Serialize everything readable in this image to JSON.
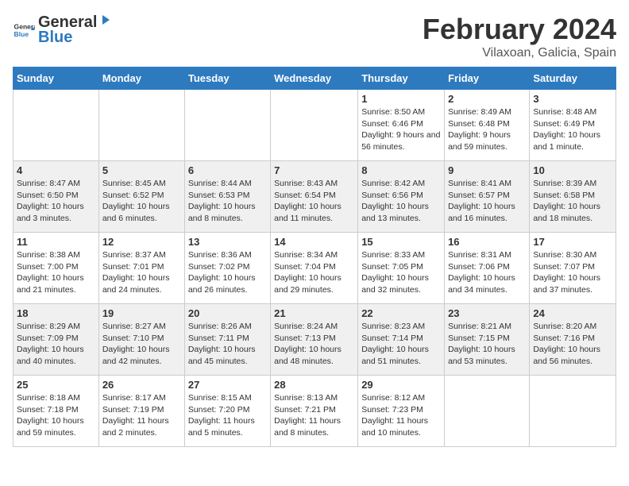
{
  "logo": {
    "text_general": "General",
    "text_blue": "Blue"
  },
  "title": "February 2024",
  "subtitle": "Vilaxoan, Galicia, Spain",
  "days_header": [
    "Sunday",
    "Monday",
    "Tuesday",
    "Wednesday",
    "Thursday",
    "Friday",
    "Saturday"
  ],
  "weeks": [
    [
      {
        "num": "",
        "info": ""
      },
      {
        "num": "",
        "info": ""
      },
      {
        "num": "",
        "info": ""
      },
      {
        "num": "",
        "info": ""
      },
      {
        "num": "1",
        "info": "Sunrise: 8:50 AM\nSunset: 6:46 PM\nDaylight: 9 hours and 56 minutes."
      },
      {
        "num": "2",
        "info": "Sunrise: 8:49 AM\nSunset: 6:48 PM\nDaylight: 9 hours and 59 minutes."
      },
      {
        "num": "3",
        "info": "Sunrise: 8:48 AM\nSunset: 6:49 PM\nDaylight: 10 hours and 1 minute."
      }
    ],
    [
      {
        "num": "4",
        "info": "Sunrise: 8:47 AM\nSunset: 6:50 PM\nDaylight: 10 hours and 3 minutes."
      },
      {
        "num": "5",
        "info": "Sunrise: 8:45 AM\nSunset: 6:52 PM\nDaylight: 10 hours and 6 minutes."
      },
      {
        "num": "6",
        "info": "Sunrise: 8:44 AM\nSunset: 6:53 PM\nDaylight: 10 hours and 8 minutes."
      },
      {
        "num": "7",
        "info": "Sunrise: 8:43 AM\nSunset: 6:54 PM\nDaylight: 10 hours and 11 minutes."
      },
      {
        "num": "8",
        "info": "Sunrise: 8:42 AM\nSunset: 6:56 PM\nDaylight: 10 hours and 13 minutes."
      },
      {
        "num": "9",
        "info": "Sunrise: 8:41 AM\nSunset: 6:57 PM\nDaylight: 10 hours and 16 minutes."
      },
      {
        "num": "10",
        "info": "Sunrise: 8:39 AM\nSunset: 6:58 PM\nDaylight: 10 hours and 18 minutes."
      }
    ],
    [
      {
        "num": "11",
        "info": "Sunrise: 8:38 AM\nSunset: 7:00 PM\nDaylight: 10 hours and 21 minutes."
      },
      {
        "num": "12",
        "info": "Sunrise: 8:37 AM\nSunset: 7:01 PM\nDaylight: 10 hours and 24 minutes."
      },
      {
        "num": "13",
        "info": "Sunrise: 8:36 AM\nSunset: 7:02 PM\nDaylight: 10 hours and 26 minutes."
      },
      {
        "num": "14",
        "info": "Sunrise: 8:34 AM\nSunset: 7:04 PM\nDaylight: 10 hours and 29 minutes."
      },
      {
        "num": "15",
        "info": "Sunrise: 8:33 AM\nSunset: 7:05 PM\nDaylight: 10 hours and 32 minutes."
      },
      {
        "num": "16",
        "info": "Sunrise: 8:31 AM\nSunset: 7:06 PM\nDaylight: 10 hours and 34 minutes."
      },
      {
        "num": "17",
        "info": "Sunrise: 8:30 AM\nSunset: 7:07 PM\nDaylight: 10 hours and 37 minutes."
      }
    ],
    [
      {
        "num": "18",
        "info": "Sunrise: 8:29 AM\nSunset: 7:09 PM\nDaylight: 10 hours and 40 minutes."
      },
      {
        "num": "19",
        "info": "Sunrise: 8:27 AM\nSunset: 7:10 PM\nDaylight: 10 hours and 42 minutes."
      },
      {
        "num": "20",
        "info": "Sunrise: 8:26 AM\nSunset: 7:11 PM\nDaylight: 10 hours and 45 minutes."
      },
      {
        "num": "21",
        "info": "Sunrise: 8:24 AM\nSunset: 7:13 PM\nDaylight: 10 hours and 48 minutes."
      },
      {
        "num": "22",
        "info": "Sunrise: 8:23 AM\nSunset: 7:14 PM\nDaylight: 10 hours and 51 minutes."
      },
      {
        "num": "23",
        "info": "Sunrise: 8:21 AM\nSunset: 7:15 PM\nDaylight: 10 hours and 53 minutes."
      },
      {
        "num": "24",
        "info": "Sunrise: 8:20 AM\nSunset: 7:16 PM\nDaylight: 10 hours and 56 minutes."
      }
    ],
    [
      {
        "num": "25",
        "info": "Sunrise: 8:18 AM\nSunset: 7:18 PM\nDaylight: 10 hours and 59 minutes."
      },
      {
        "num": "26",
        "info": "Sunrise: 8:17 AM\nSunset: 7:19 PM\nDaylight: 11 hours and 2 minutes."
      },
      {
        "num": "27",
        "info": "Sunrise: 8:15 AM\nSunset: 7:20 PM\nDaylight: 11 hours and 5 minutes."
      },
      {
        "num": "28",
        "info": "Sunrise: 8:13 AM\nSunset: 7:21 PM\nDaylight: 11 hours and 8 minutes."
      },
      {
        "num": "29",
        "info": "Sunrise: 8:12 AM\nSunset: 7:23 PM\nDaylight: 11 hours and 10 minutes."
      },
      {
        "num": "",
        "info": ""
      },
      {
        "num": "",
        "info": ""
      }
    ]
  ]
}
